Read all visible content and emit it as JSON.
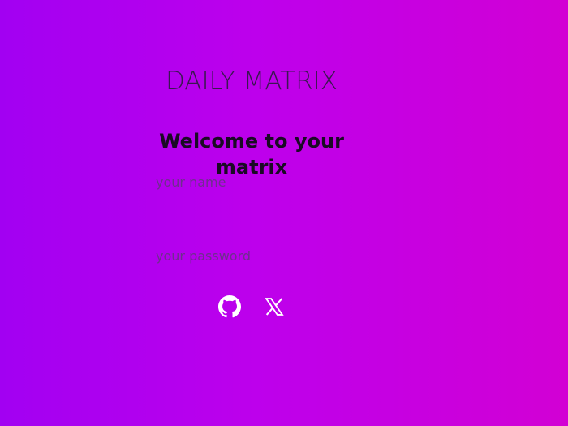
{
  "header": {
    "brand": "DAILY MATRIX"
  },
  "login": {
    "title": "Welcome to your matrix",
    "name_placeholder": "your name",
    "password_placeholder": "your password"
  },
  "socials": [
    {
      "icon": "github-icon",
      "label": "GitHub"
    },
    {
      "icon": "x-icon",
      "label": "X"
    }
  ],
  "colors": {
    "gradient_start": "#a200f2",
    "gradient_end": "#d200d4",
    "icon": "#ffffff"
  }
}
